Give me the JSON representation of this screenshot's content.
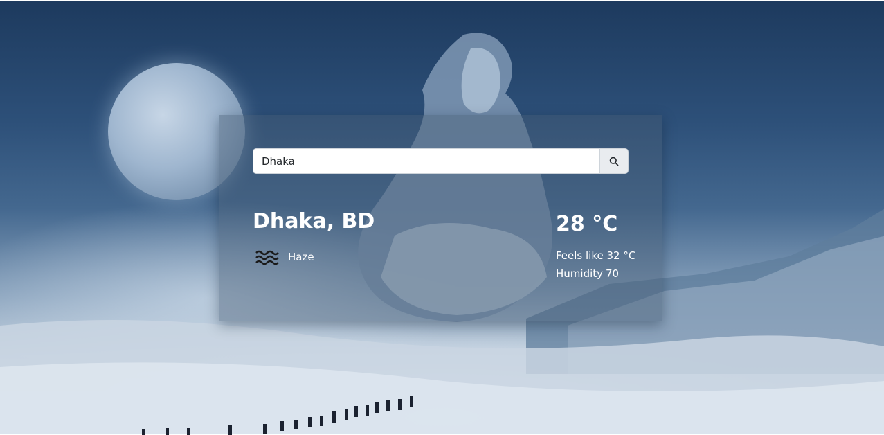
{
  "search": {
    "value": "Dhaka",
    "button_icon": "search-icon"
  },
  "weather": {
    "city": "Dhaka, BD",
    "condition": "Haze",
    "condition_icon": "haze-icon",
    "temperature": "28 °C",
    "feels_like": "Feels like 32 °C",
    "humidity_label": "Humidity",
    "humidity_value": "70"
  }
}
